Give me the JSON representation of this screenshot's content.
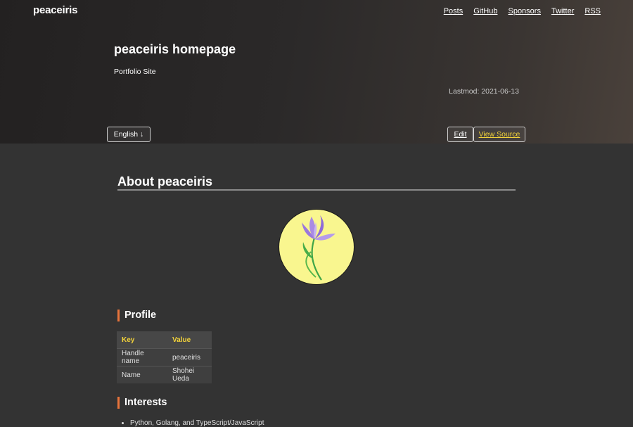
{
  "header": {
    "brand": "peaceiris",
    "nav": [
      "Posts",
      "GitHub",
      "Sponsors",
      "Twitter",
      "RSS"
    ]
  },
  "hero": {
    "title": "peaceiris homepage",
    "subtitle": "Portfolio Site",
    "lastmod": "Lastmod: 2021-06-13"
  },
  "actions": {
    "language": "English ↓",
    "edit": "Edit",
    "view_source": "View Source"
  },
  "content": {
    "about_title": "About peaceiris",
    "avatar_icon": "iris-flower-icon",
    "profile": {
      "title": "Profile",
      "headers": [
        "Key",
        "Value"
      ],
      "rows": [
        [
          "Handle name",
          "peaceiris"
        ],
        [
          "Name",
          "Shohei Ueda"
        ]
      ]
    },
    "interests": {
      "title": "Interests",
      "items": [
        "Python, Golang, and TypeScript/JavaScript"
      ]
    }
  },
  "colors": {
    "accent_yellow": "#f3d33a",
    "accent_orange": "#e8743b",
    "background": "#333333",
    "avatar_bg": "#f9f68f"
  }
}
